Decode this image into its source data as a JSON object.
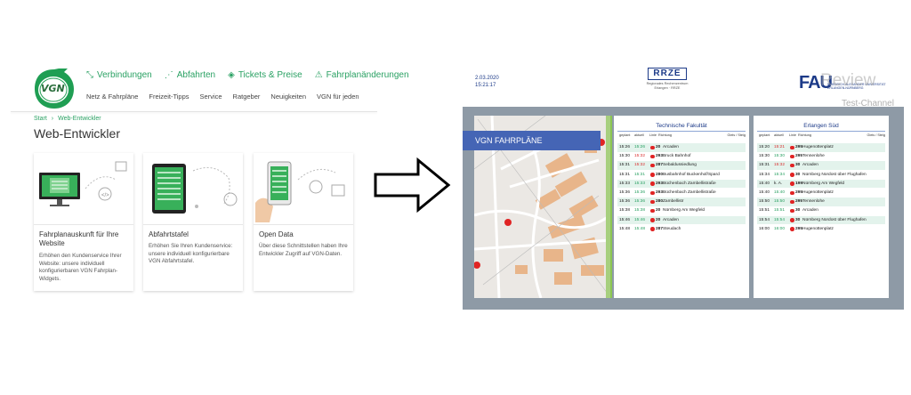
{
  "site": {
    "logo_text": "VGN",
    "top_nav": [
      {
        "label": "Verbindungen",
        "icon": "route-icon",
        "glyph": "⤡"
      },
      {
        "label": "Abfahrten",
        "icon": "nodes-icon",
        "glyph": "⋰"
      },
      {
        "label": "Tickets & Preise",
        "icon": "ticket-icon",
        "glyph": "◈"
      },
      {
        "label": "Fahrplanänderungen",
        "icon": "warning-icon",
        "glyph": "⚠"
      }
    ],
    "sub_nav": [
      "Netz & Fahrpläne",
      "Freizeit-Tipps",
      "Service",
      "Ratgeber",
      "Neuigkeiten",
      "VGN für jeden"
    ],
    "breadcrumb": {
      "start": "Start",
      "separator": "›",
      "current": "Web-Entwickler"
    },
    "page_title": "Web-Entwickler",
    "cards": [
      {
        "title": "Fahrplanauskunft für Ihre Website",
        "desc": "Erhöhen den Kundenservice Ihrer Website: unsere individuell konfigurierbaren VGN Fahrplan-Widgets."
      },
      {
        "title": "Abfahrtstafel",
        "desc": "Erhöhen Sie Ihren Kundenservice: unsere individuell konfigurierbare VGN Abfahrtstafel."
      },
      {
        "title": "Open Data",
        "desc": "Über diese Schnittstellen haben Ihre Entwickler Zugriff auf VGN-Daten."
      }
    ]
  },
  "display": {
    "date": "2.03.2020",
    "time": "15:21:17",
    "rrze_logo": "RRZE",
    "rrze_sub": "Regionales Rechenzentrum Erlangen · RRZE",
    "fau_logo": "FAU",
    "fau_sub": "FRIEDRICH-ALEXANDER UNIVERSITÄT ERLANGEN-NÜRNBERG",
    "watermark_1": "Review",
    "watermark_2": "Test-Channel",
    "map_band": "VGN FAHRPLÄNE",
    "columns": {
      "planned": "geplant",
      "actual": "aktuell",
      "line": "Linie",
      "direction": "Richtung",
      "platform": "Gleis / Steig"
    },
    "panels": [
      {
        "title": "Technische Fakultät",
        "rows": [
          {
            "planned": "15:26",
            "actual": "15:26",
            "status": "ontime",
            "line": "20",
            "dest": "Arcaden"
          },
          {
            "planned": "15:30",
            "actual": "15:32",
            "status": "late",
            "line": "293",
            "dest": "Bruck Bahnhof"
          },
          {
            "planned": "15:31",
            "actual": "15:32",
            "status": "late",
            "line": "287",
            "dest": "Sebaldussiedlung"
          },
          {
            "planned": "15:31",
            "actual": "15:31",
            "status": "ontime",
            "line": "280",
            "dest": "Busbahnhof Buckenhof/Spard"
          },
          {
            "planned": "15:33",
            "actual": "15:33",
            "status": "ontime",
            "line": "293",
            "dest": "Büchenbach Zambellistraße"
          },
          {
            "planned": "15:36",
            "actual": "15:36",
            "status": "ontime",
            "line": "293",
            "dest": "Büchenbach Zambellistraße"
          },
          {
            "planned": "15:36",
            "actual": "15:36",
            "status": "ontime",
            "line": "280",
            "dest": "Zambellistr"
          },
          {
            "planned": "15:38",
            "actual": "15:38",
            "status": "ontime",
            "line": "20",
            "dest": "Nürnberg Am Wegfeld"
          },
          {
            "planned": "15:46",
            "actual": "15:46",
            "status": "ontime",
            "line": "20",
            "dest": "Arcaden"
          },
          {
            "planned": "15:48",
            "actual": "15:48",
            "status": "ontime",
            "line": "287",
            "dest": "Steudach"
          }
        ]
      },
      {
        "title": "Erlangen Süd",
        "rows": [
          {
            "planned": "15:20",
            "actual": "15:21",
            "status": "late",
            "line": "295",
            "dest": "Hugenottenplatz"
          },
          {
            "planned": "15:30",
            "actual": "15:30",
            "status": "ontime",
            "line": "295",
            "dest": "Tennenlohe"
          },
          {
            "planned": "15:31",
            "actual": "15:32",
            "status": "late",
            "line": "30",
            "dest": "Arcaden"
          },
          {
            "planned": "15:34",
            "actual": "15:34",
            "status": "ontime",
            "line": "30",
            "dest": "Nürnberg Nordost über Flughafen"
          },
          {
            "planned": "15:40",
            "actual": "k. A.",
            "status": "none",
            "line": "199",
            "dest": "Nürnberg Am Wegfeld"
          },
          {
            "planned": "15:40",
            "actual": "15:40",
            "status": "ontime",
            "line": "295",
            "dest": "Hugenottenplatz"
          },
          {
            "planned": "15:50",
            "actual": "15:50",
            "status": "ontime",
            "line": "295",
            "dest": "Tennenlohe"
          },
          {
            "planned": "15:51",
            "actual": "15:51",
            "status": "ontime",
            "line": "30",
            "dest": "Arcaden"
          },
          {
            "planned": "15:54",
            "actual": "15:54",
            "status": "ontime",
            "line": "30",
            "dest": "Nürnberg Nordost über Flughafen"
          },
          {
            "planned": "16:00",
            "actual": "16:00",
            "status": "ontime",
            "line": "295",
            "dest": "Hugenottenplatz"
          }
        ]
      }
    ]
  }
}
